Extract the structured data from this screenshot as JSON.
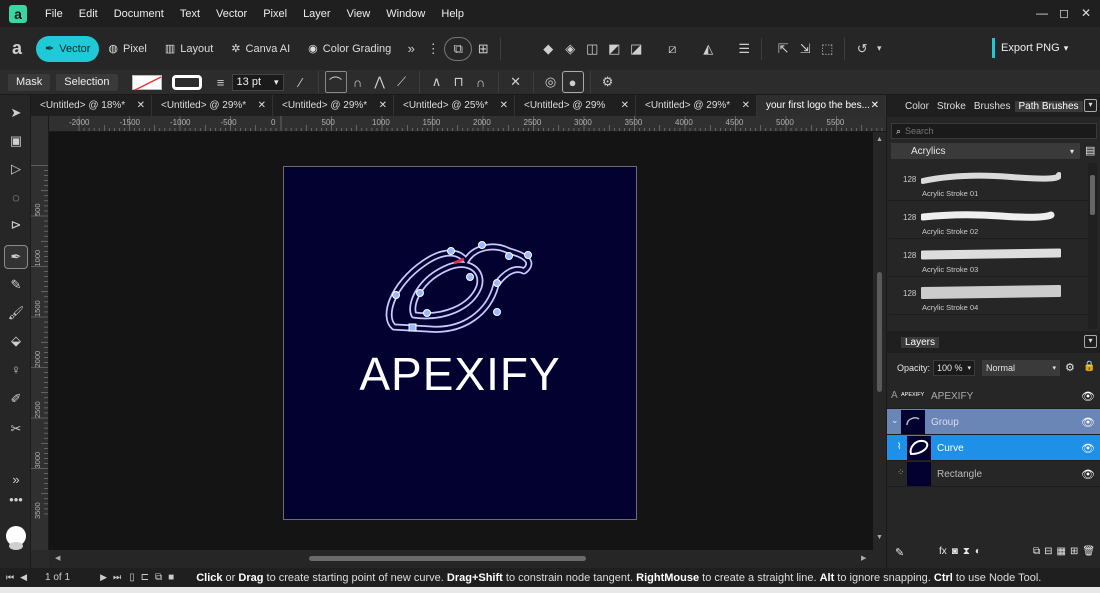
{
  "app": {
    "logo_glyph": "a",
    "accent": "#1fc9d6"
  },
  "menu": [
    "File",
    "Edit",
    "Document",
    "Text",
    "Vector",
    "Pixel",
    "Layer",
    "View",
    "Window",
    "Help"
  ],
  "window_controls": [
    "—",
    "◻",
    "✕"
  ],
  "personas": [
    {
      "label": "Vector",
      "icon": "✒"
    },
    {
      "label": "Pixel",
      "icon": "◍"
    },
    {
      "label": "Layout",
      "icon": "▥"
    },
    {
      "label": "Canva AI",
      "icon": "✲"
    },
    {
      "label": "Color Grading",
      "icon": "◉"
    }
  ],
  "export_label": "Export PNG",
  "context": {
    "mask_label": "Mask",
    "selection_label": "Selection",
    "stroke_size": "13 pt"
  },
  "tabs": [
    {
      "label": "<Untitled> @ 18%*"
    },
    {
      "label": "<Untitled> @ 29%*"
    },
    {
      "label": "<Untitled> @ 29%*"
    },
    {
      "label": "<Untitled> @ 25%*"
    },
    {
      "label": "<Untitled> @ 29%"
    },
    {
      "label": "<Untitled> @ 29%*"
    },
    {
      "label": "your first logo the bes..."
    }
  ],
  "ruler": {
    "unit": "px",
    "h_ticks": [
      "-2000",
      "-1500",
      "-1000",
      "-500",
      "0",
      "500",
      "1000",
      "1500",
      "2000",
      "2500",
      "3000",
      "3500",
      "4000",
      "4500",
      "5000",
      "5500"
    ],
    "v_ticks": [
      "500",
      "1000",
      "1500",
      "2000",
      "2500",
      "3000",
      "3500"
    ]
  },
  "canvas": {
    "logo_text": "APEXIFY",
    "artboard_bg": "#020130"
  },
  "panel_tabs": [
    "Color",
    "Stroke",
    "Brushes",
    "Path Brushes"
  ],
  "search_placeholder": "Search",
  "brush_category": "Acrylics",
  "brushes": [
    {
      "size": "128",
      "name": "Acrylic Stroke 01"
    },
    {
      "size": "128",
      "name": "Acrylic Stroke 02"
    },
    {
      "size": "128",
      "name": "Acrylic Stroke 03"
    },
    {
      "size": "128",
      "name": "Acrylic Stroke 04"
    }
  ],
  "layers_panel": {
    "title": "Layers",
    "opacity_label": "Opacity:",
    "opacity_value": "100 %",
    "blend_mode": "Normal",
    "items": [
      {
        "name": "APEXIFY",
        "thumb": "APEXIFY",
        "kind": "A"
      },
      {
        "name": "Group"
      },
      {
        "name": "Curve"
      },
      {
        "name": "Rectangle"
      }
    ]
  },
  "status": {
    "page": "1 of 1",
    "hint": [
      {
        "t": "Click",
        "b": true
      },
      {
        "t": " or ",
        "b": false
      },
      {
        "t": "Drag",
        "b": true
      },
      {
        "t": " to create starting point of new curve. ",
        "b": false
      },
      {
        "t": "Drag+Shift",
        "b": true
      },
      {
        "t": " to constrain node tangent. ",
        "b": false
      },
      {
        "t": "RightMouse",
        "b": true
      },
      {
        "t": " to create a straight line. ",
        "b": false
      },
      {
        "t": "Alt",
        "b": true
      },
      {
        "t": " to ignore snapping. ",
        "b": false
      },
      {
        "t": "Ctrl",
        "b": true
      },
      {
        "t": " to use Node Tool.",
        "b": false
      }
    ]
  }
}
